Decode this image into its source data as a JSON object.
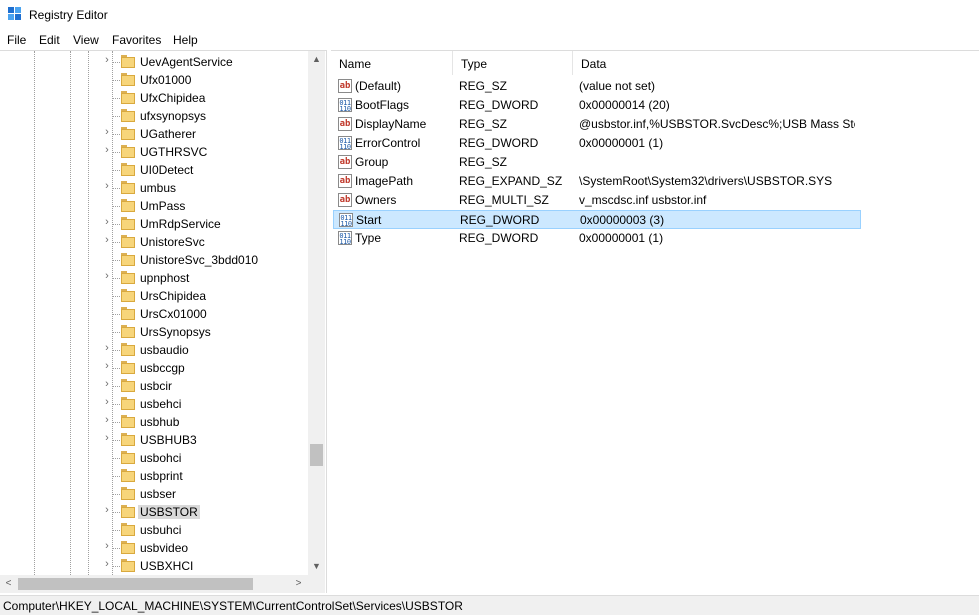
{
  "window": {
    "title": "Registry Editor"
  },
  "menu": [
    "File",
    "Edit",
    "View",
    "Favorites",
    "Help"
  ],
  "tree": {
    "items": [
      {
        "label": "UevAgentService",
        "expandable": true
      },
      {
        "label": "Ufx01000",
        "expandable": false
      },
      {
        "label": "UfxChipidea",
        "expandable": false
      },
      {
        "label": "ufxsynopsys",
        "expandable": false
      },
      {
        "label": "UGatherer",
        "expandable": true
      },
      {
        "label": "UGTHRSVC",
        "expandable": true
      },
      {
        "label": "UI0Detect",
        "expandable": false
      },
      {
        "label": "umbus",
        "expandable": true
      },
      {
        "label": "UmPass",
        "expandable": false
      },
      {
        "label": "UmRdpService",
        "expandable": true
      },
      {
        "label": "UnistoreSvc",
        "expandable": true
      },
      {
        "label": "UnistoreSvc_3bdd010",
        "expandable": false
      },
      {
        "label": "upnphost",
        "expandable": true
      },
      {
        "label": "UrsChipidea",
        "expandable": false
      },
      {
        "label": "UrsCx01000",
        "expandable": false
      },
      {
        "label": "UrsSynopsys",
        "expandable": false
      },
      {
        "label": "usbaudio",
        "expandable": true
      },
      {
        "label": "usbccgp",
        "expandable": true
      },
      {
        "label": "usbcir",
        "expandable": true
      },
      {
        "label": "usbehci",
        "expandable": true
      },
      {
        "label": "usbhub",
        "expandable": true
      },
      {
        "label": "USBHUB3",
        "expandable": true
      },
      {
        "label": "usbohci",
        "expandable": false
      },
      {
        "label": "usbprint",
        "expandable": false
      },
      {
        "label": "usbser",
        "expandable": false
      },
      {
        "label": "USBSTOR",
        "expandable": true,
        "selected": true
      },
      {
        "label": "usbuhci",
        "expandable": false
      },
      {
        "label": "usbvideo",
        "expandable": true
      },
      {
        "label": "USBXHCI",
        "expandable": true
      }
    ]
  },
  "list": {
    "columns": [
      "Name",
      "Type",
      "Data"
    ],
    "rows": [
      {
        "name": "(Default)",
        "type": "REG_SZ",
        "data": "(value not set)",
        "icon": "string-value-icon"
      },
      {
        "name": "BootFlags",
        "type": "REG_DWORD",
        "data": "0x00000014 (20)",
        "icon": "binary-value-icon"
      },
      {
        "name": "DisplayName",
        "type": "REG_SZ",
        "data": "@usbstor.inf,%USBSTOR.SvcDesc%;USB Mass Stor...",
        "icon": "string-value-icon"
      },
      {
        "name": "ErrorControl",
        "type": "REG_DWORD",
        "data": "0x00000001 (1)",
        "icon": "binary-value-icon"
      },
      {
        "name": "Group",
        "type": "REG_SZ",
        "data": "",
        "icon": "string-value-icon"
      },
      {
        "name": "ImagePath",
        "type": "REG_EXPAND_SZ",
        "data": "\\SystemRoot\\System32\\drivers\\USBSTOR.SYS",
        "icon": "string-value-icon"
      },
      {
        "name": "Owners",
        "type": "REG_MULTI_SZ",
        "data": "v_mscdsc.inf usbstor.inf",
        "icon": "string-value-icon"
      },
      {
        "name": "Start",
        "type": "REG_DWORD",
        "data": "0x00000003 (3)",
        "icon": "binary-value-icon",
        "selected": true
      },
      {
        "name": "Type",
        "type": "REG_DWORD",
        "data": "0x00000001 (1)",
        "icon": "binary-value-icon"
      }
    ]
  },
  "status": {
    "path": "Computer\\HKEY_LOCAL_MACHINE\\SYSTEM\\CurrentControlSet\\Services\\USBSTOR"
  }
}
